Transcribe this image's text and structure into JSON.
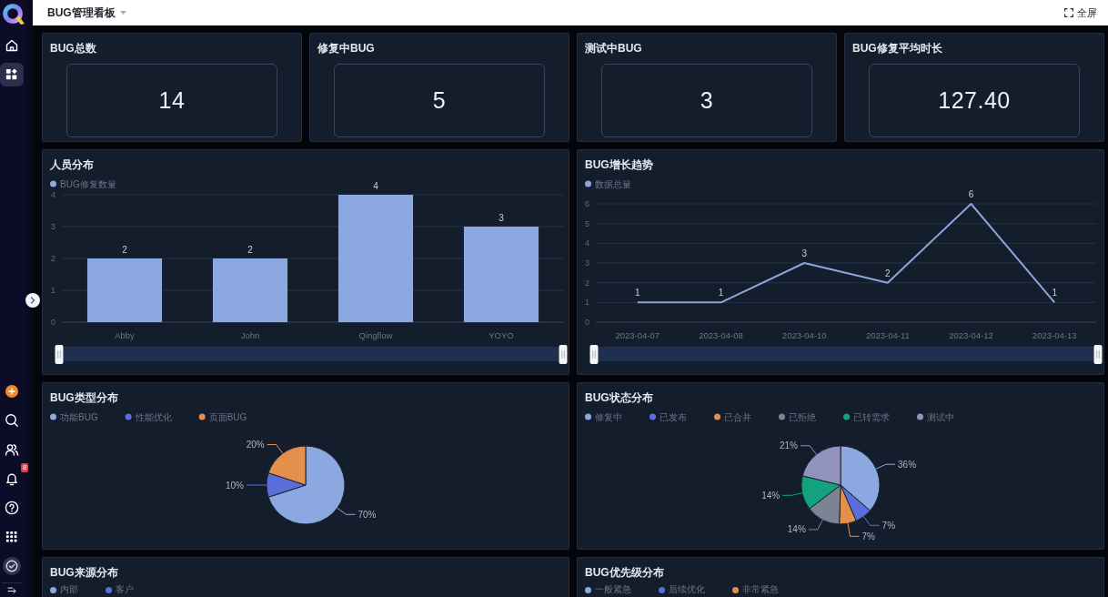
{
  "sidebar": {
    "items": [
      {
        "kind": "home",
        "selected": false
      },
      {
        "kind": "dashboard",
        "selected": true
      }
    ],
    "bottom_items": [
      {
        "kind": "create"
      },
      {
        "kind": "search"
      },
      {
        "kind": "contacts"
      },
      {
        "kind": "notifications",
        "badge": "8"
      },
      {
        "kind": "help"
      },
      {
        "kind": "apps"
      },
      {
        "kind": "profile"
      },
      {
        "kind": "collapse"
      }
    ]
  },
  "header": {
    "title": "BUG管理看板",
    "fullscreen_label": "全屏"
  },
  "metrics": [
    {
      "title": "BUG总数",
      "value": "14"
    },
    {
      "title": "修复中BUG",
      "value": "5"
    },
    {
      "title": "测试中BUG",
      "value": "3"
    },
    {
      "title": "BUG修复平均时长",
      "value": "127.40"
    }
  ],
  "charts": [
    {
      "title": "人员分布",
      "chart_data": {
        "type": "bar",
        "categories": [
          "Abby",
          "John",
          "Qingflow",
          "YOYO"
        ],
        "series": [
          {
            "name": "BUG修复数量",
            "color": "#8ba9e0",
            "values": [
              2,
              2,
              4,
              3
            ]
          }
        ],
        "ylim": [
          0,
          4
        ],
        "yticks": [
          0,
          1,
          2,
          3,
          4
        ],
        "grid": true,
        "legend": "top-left",
        "data_labels": true
      }
    },
    {
      "title": "BUG增长趋势",
      "chart_data": {
        "type": "line",
        "categories": [
          "2023-04-07",
          "2023-04-08",
          "2023-04-10",
          "2023-04-11",
          "2023-04-12",
          "2023-04-13"
        ],
        "series": [
          {
            "name": "数据总量",
            "color": "#8fa4d8",
            "values": [
              1,
              1,
              3,
              2,
              6,
              1
            ]
          }
        ],
        "ylim": [
          0,
          6
        ],
        "yticks": [
          0,
          1,
          2,
          3,
          4,
          5,
          6
        ],
        "grid": true,
        "legend": "top-left",
        "data_labels": true
      }
    },
    {
      "title": "BUG类型分布",
      "chart_data": {
        "type": "pie",
        "categories": [
          "功能BUG",
          "性能优化",
          "页面BUG"
        ],
        "values": [
          70,
          10,
          20
        ],
        "colors": [
          "#8ba9e0",
          "#5b6fdb",
          "#e58f4c"
        ],
        "legend": "top-left",
        "value_labels": [
          "70%",
          "10%",
          "20%"
        ]
      }
    },
    {
      "title": "BUG状态分布",
      "chart_data": {
        "type": "pie",
        "categories": [
          "修复中",
          "已发布",
          "已合并",
          "已拒绝",
          "已转需求",
          "测试中"
        ],
        "values": [
          36,
          7,
          7,
          14,
          14,
          21
        ],
        "colors": [
          "#8ba9e0",
          "#5b6fdb",
          "#e58f4c",
          "#7b8494",
          "#12a37e",
          "#9193bd"
        ],
        "legend": "top-left",
        "value_labels": [
          "36%",
          "7%",
          "7%",
          "14%",
          "14%",
          "21%"
        ]
      }
    },
    {
      "title": "BUG来源分布",
      "legend": [
        {
          "label": "内部",
          "color": "#8ba9e0"
        },
        {
          "label": "客户",
          "color": "#5b6fdb"
        }
      ]
    },
    {
      "title": "BUG优先级分布",
      "legend": [
        {
          "label": "一般紧急",
          "color": "#8ba9e0"
        },
        {
          "label": "后续优化",
          "color": "#5b6fdb"
        },
        {
          "label": "非常紧急",
          "color": "#e58f4c"
        }
      ]
    }
  ]
}
